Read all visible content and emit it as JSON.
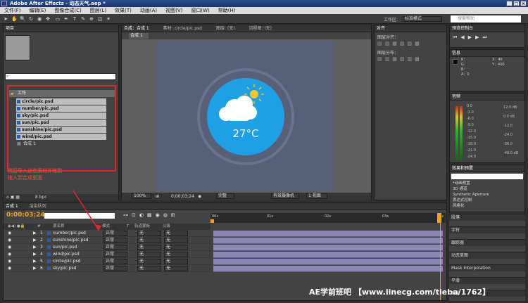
{
  "window": {
    "title": "Adobe After Effects - 动态天气.aep *"
  },
  "menu": [
    "文件(F)",
    "编辑(E)",
    "图像合成(C)",
    "图层(L)",
    "效果(T)",
    "动画(A)",
    "视图(V)",
    "窗口(W)",
    "帮助(H)"
  ],
  "workspace": {
    "label": "工作区:",
    "value": "标准模式",
    "search_placeholder": "搜索帮助"
  },
  "project": {
    "tab": "项目",
    "search_placeholder": "",
    "folder": "工作",
    "items": [
      "circle/pic.psd",
      "number/pic.psd",
      "sky/pic.psd",
      "sun/pic.psd",
      "sunshine/pic.psd",
      "wind/pic.psd"
    ],
    "comp": "合成 1",
    "depth": "8 bpc"
  },
  "composition": {
    "tabs": [
      "合成：合成 1",
      "素材: circle/pic.psd",
      "图层: (无)",
      "流程图: (无)"
    ],
    "name_tab": "合成 1",
    "temperature": "27°C",
    "zoom": "100%",
    "timecode": "0;00;03;24",
    "quality": "完整",
    "camera": "有效摄像机",
    "views": "1 视图"
  },
  "annotation": {
    "line1": "然后导入这些素材并拖到",
    "line2": "拖入到合成里面"
  },
  "align": {
    "tab": "对齐",
    "align_layers": "图层对齐：",
    "distribute": "图层分布："
  },
  "info": {
    "tab": "信息",
    "R": "R：",
    "G": "G：",
    "B": "B：",
    "A": "A：0",
    "X": "X：46",
    "Y": "Y：400"
  },
  "preview": {
    "tab": "预览控制台"
  },
  "audio": {
    "tab": "音频",
    "left_scale": [
      "0.0",
      "-3.0",
      "-6.0",
      "-9.0",
      "-12.0",
      "-15.0",
      "-18.0",
      "-21.0",
      "-24.0"
    ],
    "right_scale": [
      "12.0 dB",
      "0.0 dB",
      "-12.0",
      "-24.0",
      "-36.0",
      "-48.0 dB"
    ]
  },
  "effects": {
    "tab": "效果和预置",
    "items": [
      "*动画预置",
      "3D 通道",
      "Synthetic Aperture",
      "表达式控制",
      "风格化"
    ]
  },
  "right_panels": [
    "段落",
    "字符",
    "跟踪器",
    "动态草图",
    "Mask Interpolation",
    "平滑",
    "摇摆"
  ],
  "timeline": {
    "tabs": [
      "合成 1",
      "渲染队列"
    ],
    "timecode": "0:00:03:24",
    "headers": [
      "#",
      "源名称",
      "模式",
      "T",
      "轨道蒙板",
      "父级"
    ],
    "layers": [
      {
        "n": "1",
        "name": "number/pic.psd",
        "mode": "正常",
        "track": "无",
        "parent": "无"
      },
      {
        "n": "2",
        "name": "sunshine/pic.psd",
        "mode": "正常",
        "track": "无",
        "parent": "无"
      },
      {
        "n": "3",
        "name": "sun/pic.psd",
        "mode": "正常",
        "track": "无",
        "parent": "无"
      },
      {
        "n": "4",
        "name": "wind/pic.psd",
        "mode": "正常",
        "track": "无",
        "parent": "无"
      },
      {
        "n": "5",
        "name": "circle/pic.psd",
        "mode": "正常",
        "track": "无",
        "parent": "无"
      },
      {
        "n": "6",
        "name": "sky/pic.psd",
        "mode": "正常",
        "track": "无",
        "parent": "无"
      }
    ],
    "ruler": [
      "00s",
      "01s",
      "02s",
      "03s",
      "04s"
    ]
  },
  "watermark": "AE学前班吧 【www.linecg.com/tieba/1762】",
  "colors": {
    "accent_blue": "#1ea0e6",
    "orange_timecode": "#f0a020",
    "annotation_red": "#e0282b"
  }
}
